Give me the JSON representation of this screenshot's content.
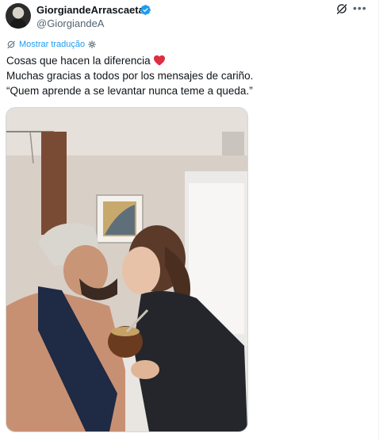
{
  "author": {
    "display_name": "GiorgiandeArrascaeta",
    "handle": "@GiorgiandeA",
    "verified": true
  },
  "translate_label": "Mostrar tradução",
  "tweet": {
    "lines": [
      "Cosas que hacen la diferencia",
      "Muchas gracias a todos por los mensajes de cariño.",
      "“Quem aprende a se levantar nunca teme a queda.”"
    ]
  },
  "colors": {
    "accent": "#1d9bf0",
    "secondary_text": "#536471",
    "heart": "#f91880"
  },
  "icons": [
    "verified-badge-icon",
    "grok-icon",
    "more-icon",
    "translate-icon",
    "gear-icon",
    "heart-emoji-icon"
  ]
}
